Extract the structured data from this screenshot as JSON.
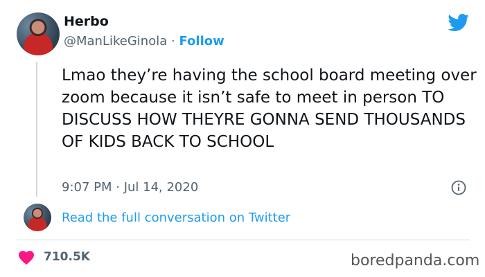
{
  "tweet": {
    "display_name": "Herbo",
    "handle": "@ManLikeGinola",
    "separator": "·",
    "follow_label": "Follow",
    "text": "Lmao they’re having the school board meeting over zoom because it isn’t safe to meet in person TO DISCUSS HOW THEYRE GONNA SEND THOUSANDS OF KIDS BACK TO SCHOOL",
    "timestamp": "9:07 PM · Jul 14, 2020",
    "read_more_label": "Read the full conversation on Twitter",
    "likes": "710.5K"
  },
  "icons": {
    "brand": "twitter-bird-icon",
    "info": "info-icon",
    "like": "heart-icon"
  },
  "colors": {
    "accent": "#1d9bf0",
    "like": "#f91880",
    "muted": "#536471"
  },
  "watermark": "boredpanda.com"
}
